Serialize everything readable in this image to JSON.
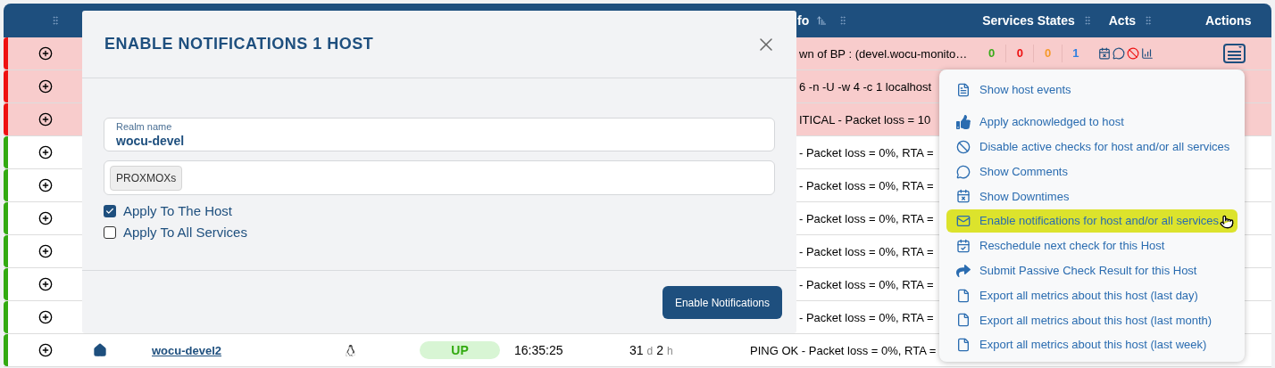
{
  "header": {
    "info_label": "fo",
    "services_label": "Services States",
    "acts_label": "Acts",
    "actions_label": "Actions"
  },
  "rows": [
    {
      "color": "#ee1111",
      "highlighted": true,
      "info": "wn of BP : (devel.wocu-monito…",
      "services_states": [
        {
          "value": "0",
          "color": "#3aaa1a"
        },
        {
          "value": "0",
          "color": "#ee1111"
        },
        {
          "value": "0",
          "color": "#f59a2a"
        },
        {
          "value": "1",
          "color": "#2f7fe0"
        }
      ]
    },
    {
      "color": "#ee1111",
      "highlighted": true,
      "info": "6 -n -U -w 4 -c 1 localhost"
    },
    {
      "color": "#ee1111",
      "highlighted": true,
      "info": "ITICAL - Packet loss = 10"
    },
    {
      "color": "#33aa11",
      "highlighted": false,
      "info": "- Packet loss = 0%, RTA ="
    },
    {
      "color": "#33aa11",
      "highlighted": false,
      "info": "- Packet loss = 0%, RTA ="
    },
    {
      "color": "#33aa11",
      "highlighted": false,
      "info": "- Packet loss = 0%, RTA ="
    },
    {
      "color": "#33aa11",
      "highlighted": false,
      "info": "- Packet loss = 0%, RTA ="
    },
    {
      "color": "#33aa11",
      "highlighted": false,
      "info": "- Packet loss = 0%, RTA ="
    },
    {
      "color": "#33aa11",
      "highlighted": false,
      "info": "- Packet loss = 0%, RTA ="
    },
    {
      "color": "#33aa11",
      "highlighted": false,
      "name": "wocu-devel2",
      "state": "UP",
      "time": "16:35:25",
      "duration": [
        {
          "text": "31",
          "kind": "value"
        },
        {
          "text": "d",
          "kind": "unit"
        },
        {
          "text": "2",
          "kind": "value"
        },
        {
          "text": "h",
          "kind": "unit"
        }
      ],
      "info": "PING OK - Packet loss = 0%, RTA ="
    }
  ],
  "modal": {
    "title": "ENABLE NOTIFICATIONS 1 HOST",
    "realm": {
      "label": "Realm name",
      "value": "wocu-devel"
    },
    "tags": [
      "PROXMOXs"
    ],
    "checkboxes": [
      {
        "label": "Apply To The Host",
        "checked": true
      },
      {
        "label": "Apply To All Services",
        "checked": false
      }
    ],
    "button": "Enable Notifications"
  },
  "menu": {
    "items": [
      {
        "label": "Show host events",
        "kind": "document",
        "selected": false
      },
      {
        "label": "Apply acknowledged to host",
        "kind": "thumbs-up",
        "selected": false
      },
      {
        "label": "Disable active checks for host and/or all services",
        "kind": "ban",
        "selected": false
      },
      {
        "label": "Show Comments",
        "kind": "comment",
        "selected": false
      },
      {
        "label": "Show Downtimes",
        "kind": "calendar-x",
        "selected": false
      },
      {
        "label": "Enable notifications for host and/or all services",
        "kind": "mail",
        "selected": true
      },
      {
        "label": "Reschedule next check for this Host",
        "kind": "calendar-check",
        "selected": false
      },
      {
        "label": "Submit Passive Check Result for this Host",
        "kind": "share",
        "selected": false
      },
      {
        "label": "Export all metrics about this host (last day)",
        "kind": "pdf",
        "selected": false
      },
      {
        "label": "Export all metrics about this host (last month)",
        "kind": "pdf",
        "selected": false
      },
      {
        "label": "Export all metrics about this host (last week)",
        "kind": "pdf",
        "selected": false
      }
    ]
  }
}
